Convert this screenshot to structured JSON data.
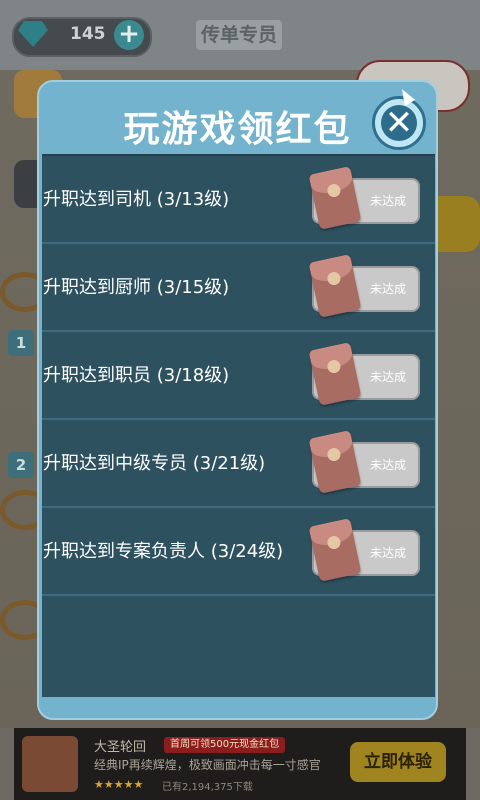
{
  "hud": {
    "gem_count": "145",
    "plus_label": "+",
    "rank_title": "传单专员"
  },
  "background": {
    "level_markers": [
      "1",
      "2"
    ]
  },
  "modal": {
    "title": "玩游戏领红包",
    "close_label": "✕",
    "tasks": [
      {
        "label": "升职达到司机 (3/13级)",
        "button": "未达成"
      },
      {
        "label": "升职达到厨师 (3/15级)",
        "button": "未达成"
      },
      {
        "label": "升职达到职员 (3/18级)",
        "button": "未达成"
      },
      {
        "label": "升职达到中级专员 (3/21级)",
        "button": "未达成"
      },
      {
        "label": "升职达到专案负责人 (3/24级)",
        "button": "未达成"
      }
    ]
  },
  "ad": {
    "title": "大圣轮回",
    "badge": "首周可领500元现金红包",
    "description": "经典IP再续辉煌，极致画面冲击每一寸感官",
    "stars": "★★★★★",
    "downloads": "已有2,194,375下载",
    "cta": "立即体验"
  },
  "colors": {
    "modal_frame": "#73b3cd",
    "list_bg": "#2e5160",
    "button_disabled": "#c9c9c9",
    "envelope": "#a86c63"
  }
}
